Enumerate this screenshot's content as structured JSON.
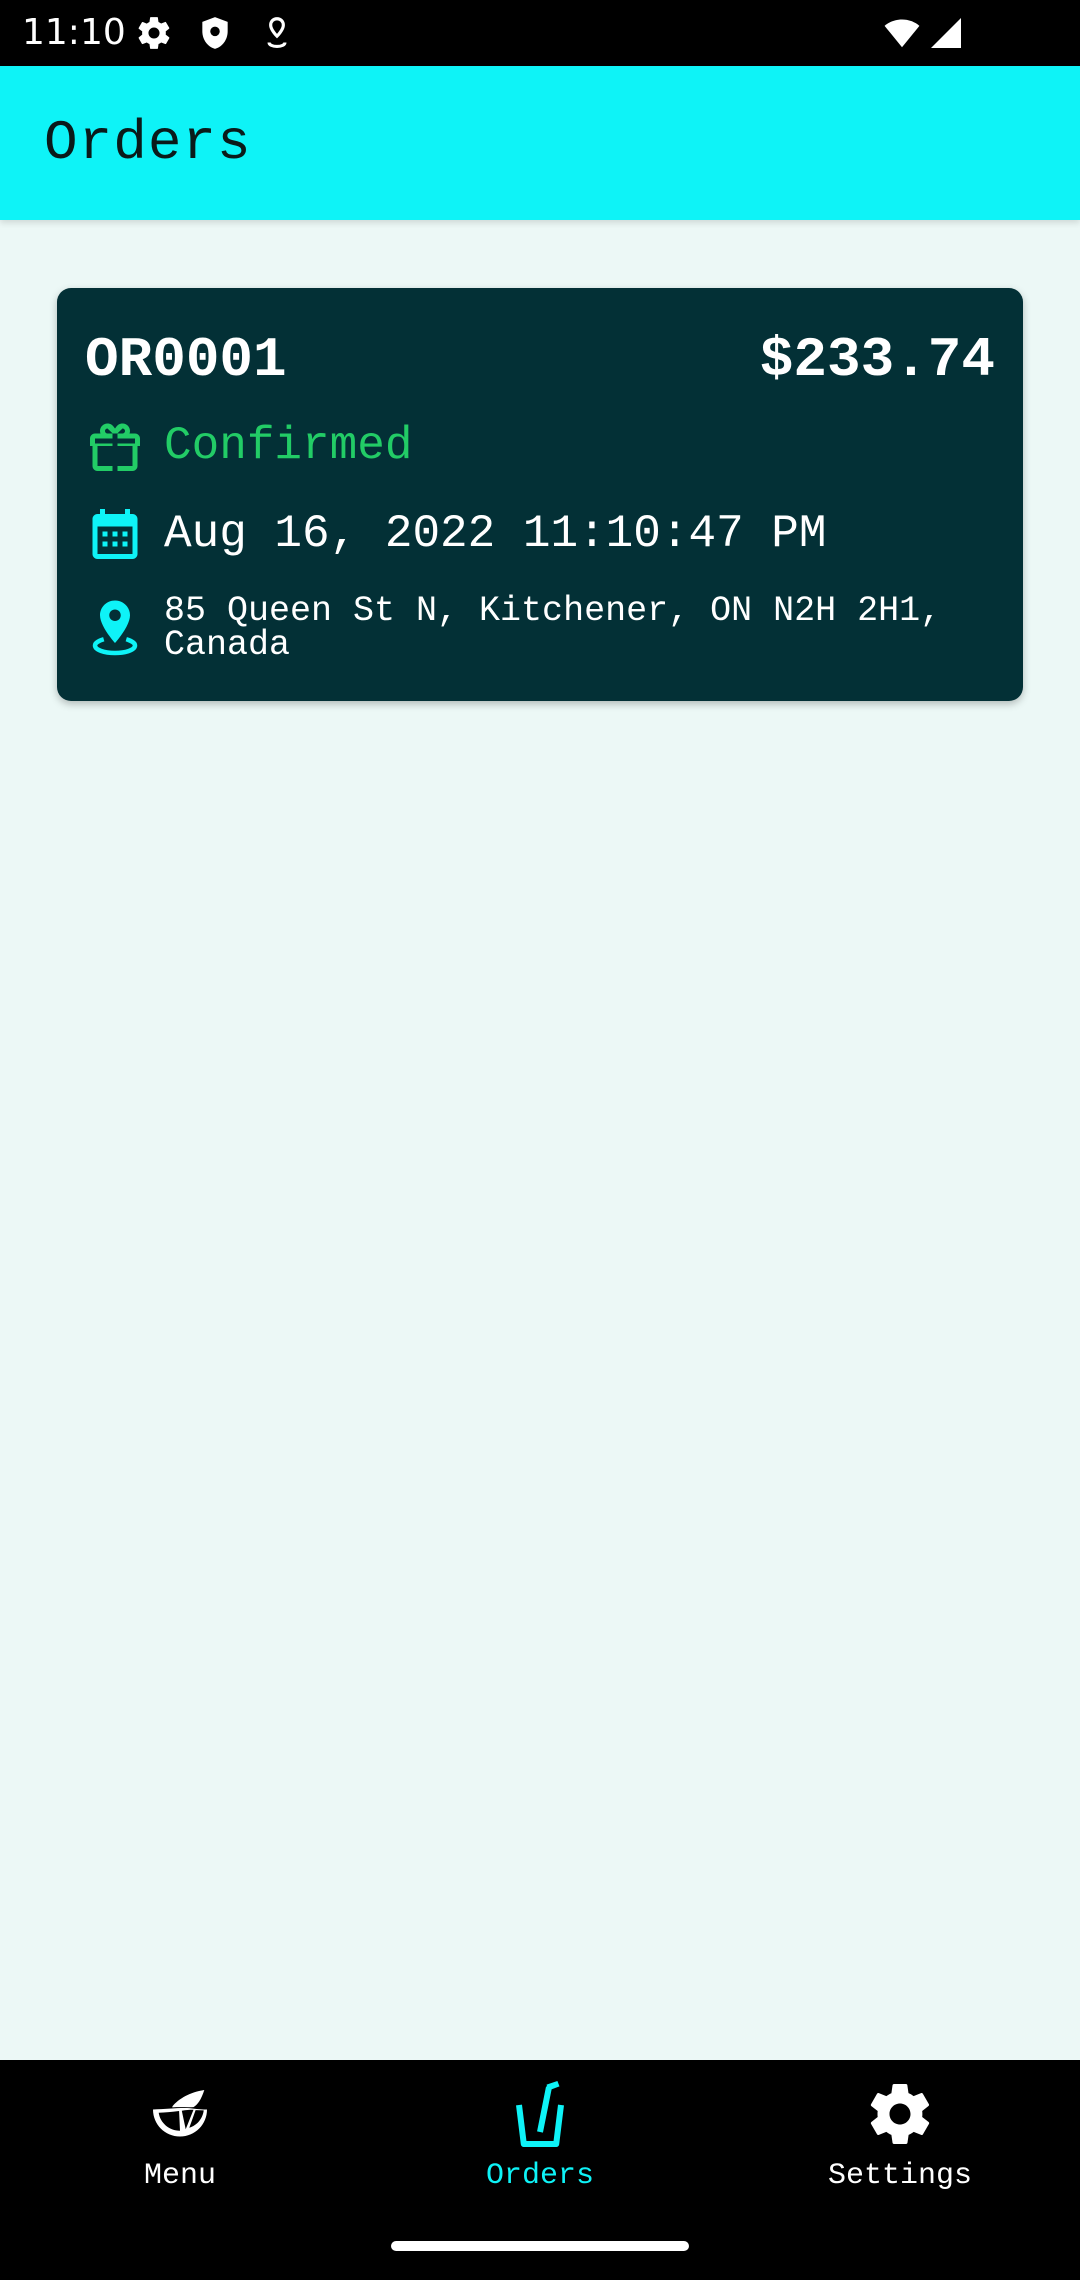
{
  "status_bar": {
    "time": "11:10",
    "icons": [
      "gear-icon",
      "shield-icon",
      "location-pin-icon",
      "wifi-icon",
      "signal-icon"
    ]
  },
  "app_bar": {
    "title": "Orders",
    "background_color": "#0ef3f7"
  },
  "orders": [
    {
      "id": "OR0001",
      "total": "$233.74",
      "status": "Confirmed",
      "status_color": "#22cc66",
      "date": "Aug 16, 2022 11:10:47 PM",
      "address": "85 Queen St N, Kitchener, ON N2H 2H1, Canada"
    }
  ],
  "bottom_nav": {
    "items": [
      {
        "label": "Menu",
        "icon": "lime-slice-icon",
        "active": false
      },
      {
        "label": "Orders",
        "icon": "drink-cup-icon",
        "active": true
      },
      {
        "label": "Settings",
        "icon": "gear-icon",
        "active": false
      }
    ],
    "active_color": "#0ef3f7"
  }
}
